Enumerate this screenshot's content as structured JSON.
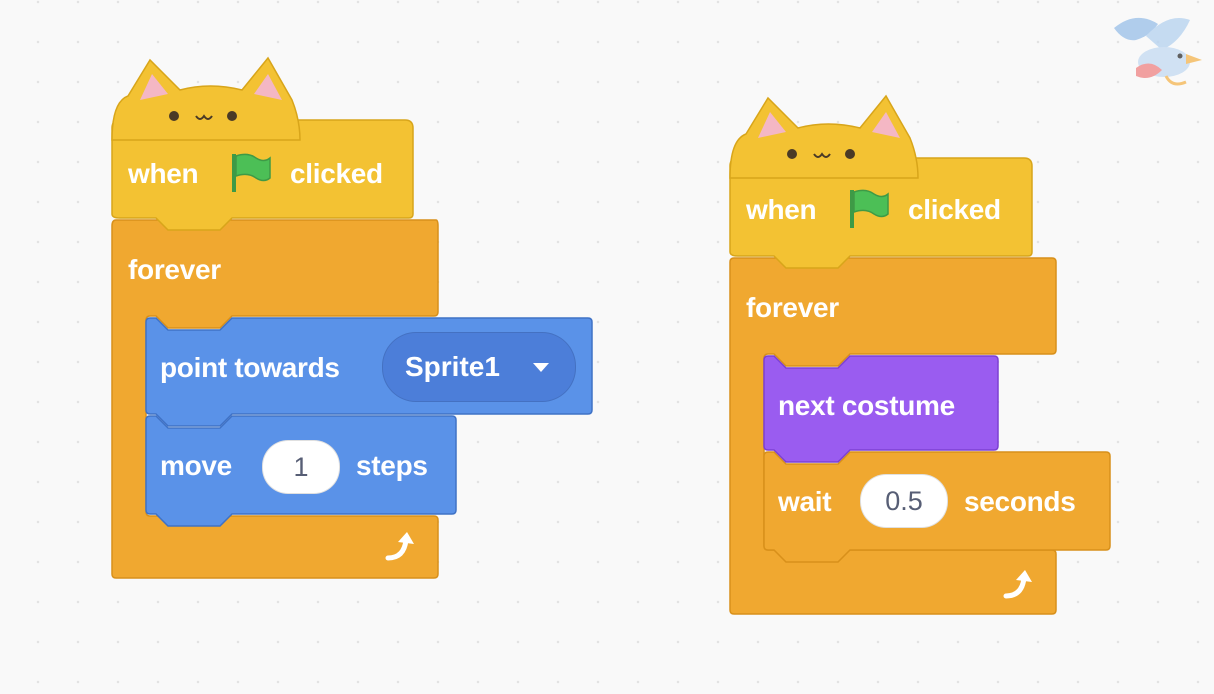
{
  "scripts": [
    {
      "hat_block": {
        "when_label": "when",
        "flag_icon": "green-flag-icon",
        "clicked_label": "clicked"
      },
      "forever_block": {
        "label": "forever",
        "loop_icon": "loop-arrow-icon"
      },
      "point_towards_block": {
        "label": "point towards",
        "target_value": "Sprite1"
      },
      "move_block": {
        "move_label": "move",
        "steps_value": "1",
        "steps_label": "steps"
      }
    },
    {
      "hat_block": {
        "when_label": "when",
        "flag_icon": "green-flag-icon",
        "clicked_label": "clicked"
      },
      "forever_block": {
        "label": "forever",
        "loop_icon": "loop-arrow-icon"
      },
      "next_costume_block": {
        "label": "next costume"
      },
      "wait_block": {
        "wait_label": "wait",
        "seconds_value": "0.5",
        "seconds_label": "seconds"
      }
    }
  ],
  "colors": {
    "events_yellow": "#FFBF00",
    "control_orange": "#FFAB19",
    "motion_blue": "#4C97FF",
    "looks_purple": "#9966FF",
    "flag_green": "#4CBF56"
  },
  "icons": [
    "cat-ears-icon",
    "green-flag-icon",
    "loop-arrow-icon",
    "bird-mascot-icon"
  ]
}
